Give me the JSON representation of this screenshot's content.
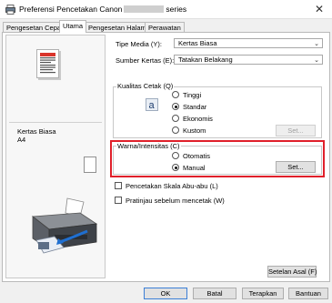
{
  "window": {
    "title_prefix": "Preferensi Pencetakan Canon",
    "title_suffix": "series",
    "close_glyph": "✕"
  },
  "tabs": [
    {
      "label": "Pengesetan Cepat"
    },
    {
      "label": "Utama"
    },
    {
      "label": "Pengesetan Halaman"
    },
    {
      "label": "Perawatan"
    }
  ],
  "preview": {
    "media_name": "Kertas Biasa",
    "paper_size": "A4"
  },
  "media": {
    "type_label": "Tipe Media (Y):",
    "type_value": "Kertas Biasa",
    "source_label": "Sumber Kertas (E):",
    "source_value": "Tatakan Belakang"
  },
  "quality": {
    "title": "Kualitas Cetak (Q)",
    "options": [
      "Tinggi",
      "Standar",
      "Ekonomis",
      "Kustom"
    ],
    "selected": "Standar",
    "set_button": "Set..."
  },
  "color": {
    "title": "Warna/Intensitas (C)",
    "options": [
      "Otomatis",
      "Manual"
    ],
    "selected": "Manual",
    "set_button": "Set..."
  },
  "checkboxes": {
    "grayscale": "Pencetakan Skala Abu-abu (L)",
    "preview_before": "Pratinjau sebelum mencetak (W)"
  },
  "buttons": {
    "defaults": "Setelan Asal (F)",
    "ok": "OK",
    "cancel": "Batal",
    "apply": "Terapkan",
    "help": "Bantuan"
  },
  "icons": {
    "app": "printer-icon",
    "quality": "letter-a-quality-icon",
    "printer_illustration": "printer-illustration-icon"
  },
  "colors": {
    "highlight": "#e0202a",
    "accent": "#1f6fd1"
  }
}
